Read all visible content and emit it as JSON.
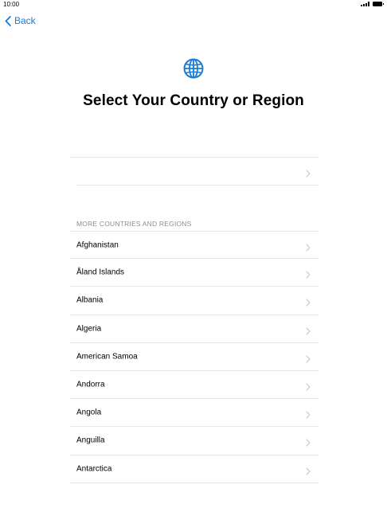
{
  "status_bar": {
    "time": "10:00"
  },
  "nav": {
    "back_label": "Back"
  },
  "header": {
    "title": "Select Your Country or Region",
    "icon": "globe-icon"
  },
  "suggested": {
    "label": ""
  },
  "more_section": {
    "header": "MORE COUNTRIES AND REGIONS",
    "items": [
      {
        "label": "Afghanistan"
      },
      {
        "label": "Åland Islands"
      },
      {
        "label": "Albania"
      },
      {
        "label": "Algeria"
      },
      {
        "label": "American Samoa"
      },
      {
        "label": "Andorra"
      },
      {
        "label": "Angola"
      },
      {
        "label": "Anguilla"
      },
      {
        "label": "Antarctica"
      }
    ]
  },
  "colors": {
    "accent": "#1a7bd6",
    "divider": "#e8e8e8",
    "chevron": "#c7c7cc",
    "section_header": "#8e8e93"
  }
}
